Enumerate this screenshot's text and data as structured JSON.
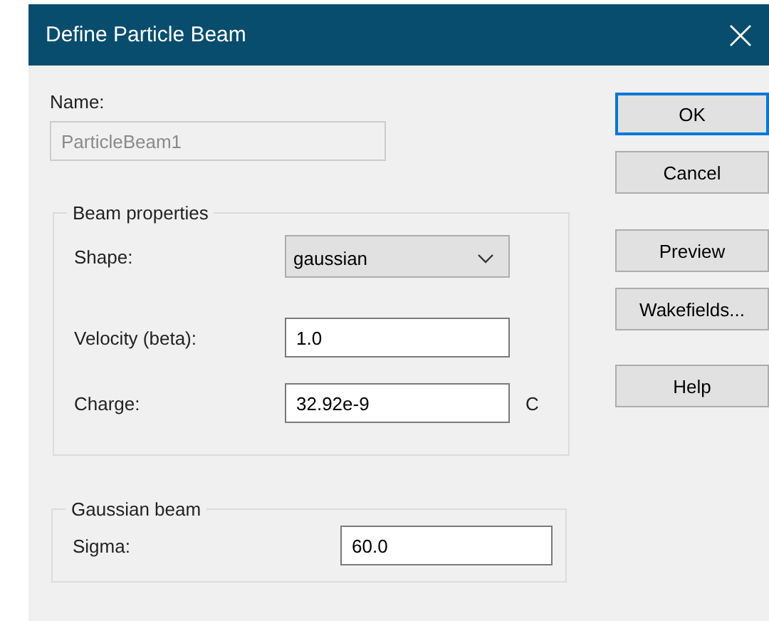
{
  "window": {
    "title": "Define Particle Beam"
  },
  "name": {
    "label": "Name:",
    "value": "ParticleBeam1",
    "disabled": true
  },
  "groups": [
    {
      "legend": "Beam properties",
      "fields": [
        {
          "kind": "dropdown",
          "label": "Shape:",
          "value": "gaussian"
        },
        {
          "kind": "text",
          "label": "Velocity (beta):",
          "value": "1.0"
        },
        {
          "kind": "text",
          "label": "Charge:",
          "value": "32.92e-9",
          "unit": "C"
        }
      ]
    },
    {
      "legend": "Gaussian beam",
      "fields": [
        {
          "kind": "text",
          "label": "Sigma:",
          "value": "60.0"
        }
      ]
    }
  ],
  "button_groups": [
    [
      {
        "label": "OK",
        "default": true
      },
      {
        "label": "Cancel",
        "default": false
      }
    ],
    [
      {
        "label": "Preview",
        "default": false
      },
      {
        "label": "Wakefields...",
        "default": false
      }
    ],
    [
      {
        "label": "Help",
        "default": false
      }
    ]
  ]
}
